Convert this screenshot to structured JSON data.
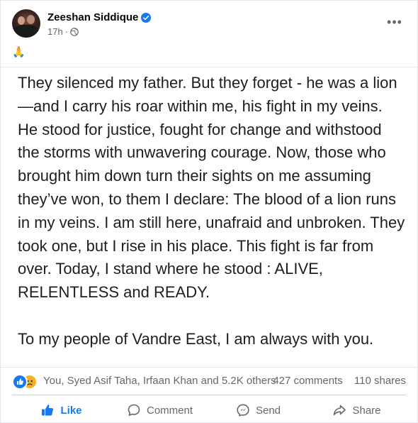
{
  "post": {
    "author": "Zeeshan Siddique",
    "timestamp": "17h",
    "audience_icon": "globe-icon",
    "emoji": "🙏",
    "text": "They silenced my father. But they forget - he was a lion—and I carry his roar within me, his fight in my veins. He stood for justice, fought for change and withstood the storms with unwavering courage. Now, those who brought him down turn their sights on me assuming they’ve won, to them I declare: The blood of a lion runs in my veins. I am still here, unafraid and unbroken. They took one, but I rise in his place. This fight is far from over. Today, I stand where he stood : ALIVE, RELENTLESS and READY.\n\nTo my people of Vandre East, I am always with you."
  },
  "engagement": {
    "reaction_icons": [
      "like-reaction-icon",
      "sad-reaction-icon"
    ],
    "reactors": "You, Syed Asif Taha, Irfaan Khan and 5.2K others",
    "comments": "427 comments",
    "shares": "110 shares"
  },
  "actions": {
    "like": "Like",
    "comment": "Comment",
    "send": "Send",
    "share": "Share"
  },
  "colors": {
    "accent": "#1877f2",
    "secondary_text": "#65676b",
    "sad_reaction": "#f7b125"
  }
}
